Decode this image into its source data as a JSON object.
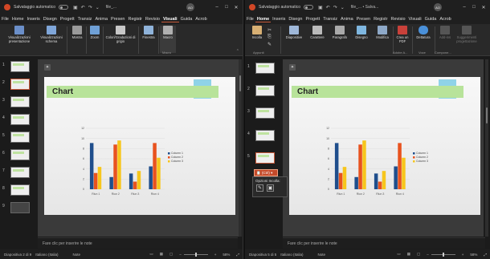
{
  "left": {
    "autosave_label": "Salvataggio automatico",
    "file_name": "file_...",
    "avatar": "AO",
    "tabs": [
      "File",
      "Home",
      "Inserisci",
      "Disegno",
      "Progettazione",
      "Transizioni",
      "Animazioni",
      "Presentazione",
      "Registrazione",
      "Revisione",
      "Visualizza",
      "Guida",
      "Acrobat"
    ],
    "tabs_short": [
      "File",
      "Home",
      "Inseris",
      "Disegn",
      "Progett",
      "Transiz",
      "Anima",
      "Presen",
      "Registr",
      "Revisio",
      "Visuali",
      "Guida",
      "Acrob"
    ],
    "active_tab": "Visuali",
    "ribbon": {
      "b1": "Visualizzazioni presentazione",
      "b2": "Visualizzazioni schema",
      "b3": "Mostra",
      "b4": "Zoom",
      "b5": "Colori/Gradazioni di grigio",
      "b6": "Finestra",
      "b7": "Macro",
      "g_macro": "Macro"
    },
    "slide_numbers": [
      "1",
      "2",
      "3",
      "4",
      "5",
      "6",
      "7",
      "8",
      "9"
    ],
    "chart_title": "Chart",
    "notes": "Fare clic per inserire le note",
    "status": {
      "slide": "Diapositiva 2 di 9",
      "lang": "Italiano (Italia)",
      "notes": "Note",
      "zoom": "58%"
    }
  },
  "right": {
    "autosave_label": "Salvataggio automatico",
    "file_name": "file_... • Salva...",
    "avatar": "AO",
    "tabs": [
      "File",
      "Home",
      "Inserisci",
      "Disegno",
      "Progettazione",
      "Transizioni",
      "Animazioni",
      "Presentazione",
      "Registrazione",
      "Revisione",
      "Visualizza",
      "Guida",
      "Acrobat"
    ],
    "tabs_short": [
      "File",
      "Home",
      "Inseris",
      "Disegn",
      "Progett",
      "Transiz",
      "Anima",
      "Presen",
      "Registr",
      "Revisio",
      "Visuali",
      "Guida",
      "Acrob"
    ],
    "active_tab": "Home",
    "ribbon": {
      "b1": "Incolla",
      "b2": "Diapositive",
      "b3": "Carattere",
      "b4": "Paragrafo",
      "b5": "Disegno",
      "b6": "Modifica",
      "b7": "Crea un PDF",
      "b8": "Dettatura",
      "b9": "Add-ins",
      "b10": "Suggerimenti progettazione",
      "g1": "Appunti",
      "g2": "Adobe A...",
      "g3": "Voce",
      "g4": "Compone..."
    },
    "slide_numbers": [
      "1",
      "2",
      "3",
      "4",
      "5"
    ],
    "chart_title": "Chart",
    "paste_chip": "(Ctrl)",
    "paste_title": "Opzioni Incolla:",
    "notes": "Fare clic per inserire le note",
    "status": {
      "slide": "Diapositiva 5 di 5",
      "lang": "Italiano (Italia)",
      "notes": "Note",
      "zoom": "58%"
    }
  },
  "chart_data": {
    "type": "bar",
    "categories": [
      "Riun 1",
      "Riun 2",
      "Riun 3",
      "Riun 4"
    ],
    "series": [
      {
        "name": "Column 1",
        "values": [
          9.1,
          2.4,
          3.1,
          4.5
        ],
        "color": "#1f4e8c"
      },
      {
        "name": "Column 2",
        "values": [
          3.2,
          8.8,
          1.5,
          9.1
        ],
        "color": "#e8521e"
      },
      {
        "name": "Column 3",
        "values": [
          4.4,
          9.6,
          3.6,
          6.2
        ],
        "color": "#f7c61c"
      }
    ],
    "yticks": [
      "0",
      "2",
      "4",
      "6",
      "8",
      "10",
      "12"
    ],
    "ylim": [
      0,
      12
    ],
    "legend": "right"
  }
}
